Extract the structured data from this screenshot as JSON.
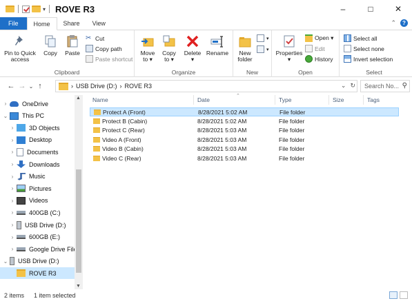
{
  "window": {
    "title": "ROVE R3",
    "minimize": "–",
    "maximize": "□",
    "close": "✕"
  },
  "ribbon_tabs": [
    "File",
    "Home",
    "Share",
    "View"
  ],
  "ribbon": {
    "clipboard": {
      "label": "Clipboard",
      "pin_line1": "Pin to Quick",
      "pin_line2": "access",
      "copy": "Copy",
      "paste": "Paste",
      "cut": "Cut",
      "copy_path": "Copy path",
      "paste_shortcut": "Paste shortcut"
    },
    "organize": {
      "label": "Organize",
      "move_line1": "Move",
      "move_line2": "to ▾",
      "copyto_line1": "Copy",
      "copyto_line2": "to ▾",
      "delete_line1": "Delete",
      "delete_line2": "▾",
      "rename": "Rename"
    },
    "new": {
      "label": "New",
      "new_folder_line1": "New",
      "new_folder_line2": "folder"
    },
    "open": {
      "label": "Open",
      "properties_line1": "Properties",
      "properties_line2": "▾",
      "open": "Open ▾",
      "edit": "Edit",
      "history": "History"
    },
    "select": {
      "label": "Select",
      "select_all": "Select all",
      "select_none": "Select none",
      "invert": "Invert selection"
    }
  },
  "address": {
    "path_parts": [
      "USB Drive (D:)",
      "ROVE R3"
    ],
    "sep": "›",
    "search_placeholder": "Search No..."
  },
  "nav_tree": [
    {
      "label": "OneDrive",
      "chev": "›",
      "icon": "cloud-icon",
      "indent": 0,
      "selected": false
    },
    {
      "label": "This PC",
      "chev": "⌄",
      "icon": "computer-icon",
      "indent": 0,
      "selected": false
    },
    {
      "label": "3D Objects",
      "chev": "›",
      "icon": "cube-icon",
      "indent": 1,
      "selected": false
    },
    {
      "label": "Desktop",
      "chev": "›",
      "icon": "desktop-icon",
      "indent": 1,
      "selected": false
    },
    {
      "label": "Documents",
      "chev": "›",
      "icon": "document-icon",
      "indent": 1,
      "selected": false
    },
    {
      "label": "Downloads",
      "chev": "›",
      "icon": "download-icon",
      "indent": 1,
      "selected": false
    },
    {
      "label": "Music",
      "chev": "›",
      "icon": "music-icon",
      "indent": 1,
      "selected": false
    },
    {
      "label": "Pictures",
      "chev": "›",
      "icon": "pictures-icon",
      "indent": 1,
      "selected": false
    },
    {
      "label": "Videos",
      "chev": "›",
      "icon": "videos-icon",
      "indent": 1,
      "selected": false
    },
    {
      "label": "400GB (C:)",
      "chev": "›",
      "icon": "drive-icon",
      "indent": 1,
      "selected": false
    },
    {
      "label": "USB Drive (D:)",
      "chev": "›",
      "icon": "usb-icon",
      "indent": 1,
      "selected": false
    },
    {
      "label": "600GB (E:)",
      "chev": "›",
      "icon": "drive-icon",
      "indent": 1,
      "selected": false
    },
    {
      "label": "Google Drive File",
      "chev": "›",
      "icon": "drive-icon",
      "indent": 1,
      "selected": false
    },
    {
      "label": "USB Drive (D:)",
      "chev": "⌄",
      "icon": "usb-icon",
      "indent": 0,
      "selected": false
    },
    {
      "label": "ROVE R3",
      "chev": "",
      "icon": "folder-icon",
      "indent": 1,
      "selected": true
    }
  ],
  "columns": {
    "name": "Name",
    "date": "Date",
    "type": "Type",
    "size": "Size",
    "tags": "Tags"
  },
  "files": [
    {
      "name": "Protect A (Front)",
      "date": "8/28/2021 5:02 AM",
      "type": "File folder",
      "selected": true
    },
    {
      "name": "Protect B (Cabin)",
      "date": "8/28/2021 5:02 AM",
      "type": "File folder",
      "selected": false
    },
    {
      "name": "Protect C (Rear)",
      "date": "8/28/2021 5:03 AM",
      "type": "File folder",
      "selected": false
    },
    {
      "name": "Video A (Front)",
      "date": "8/28/2021 5:03 AM",
      "type": "File folder",
      "selected": false
    },
    {
      "name": "Video B (Cabin)",
      "date": "8/28/2021 5:03 AM",
      "type": "File folder",
      "selected": false
    },
    {
      "name": "Video C (Rear)",
      "date": "8/28/2021 5:03 AM",
      "type": "File folder",
      "selected": false
    }
  ],
  "status": {
    "items": "2 items",
    "selected": "1 item selected"
  }
}
